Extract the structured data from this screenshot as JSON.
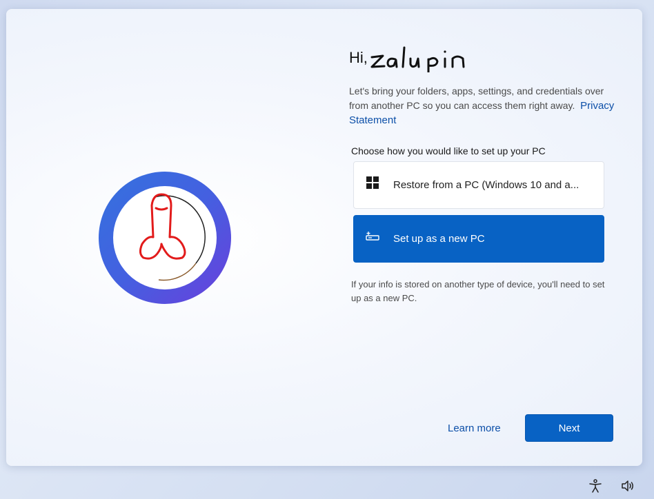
{
  "greeting": {
    "hi": "Hi,",
    "user_name": "Zalupin"
  },
  "intro": {
    "text": "Let's bring your folders, apps, settings, and credentials over from another PC so you can access them right away.",
    "privacy_link": "Privacy Statement"
  },
  "prompt": "Choose how you would like to set up your PC",
  "options": [
    {
      "label": "Restore from a PC (Windows 10 and a...",
      "icon": "windows-logo-icon",
      "selected": false
    },
    {
      "label": "Set up as a new PC",
      "icon": "new-pc-icon",
      "selected": true
    }
  ],
  "note": "If your info is stored on another type of device, you'll need to set up as a new PC.",
  "footer": {
    "learn_more": "Learn more",
    "next": "Next"
  },
  "taskbar": {
    "icons": [
      "accessibility-icon",
      "volume-icon"
    ]
  },
  "colors": {
    "accent": "#0862c4",
    "link": "#0c4fa8",
    "avatar_ring_start": "#3472de",
    "avatar_ring_end": "#6a3fdc",
    "drawing_red": "#e21b1b"
  }
}
